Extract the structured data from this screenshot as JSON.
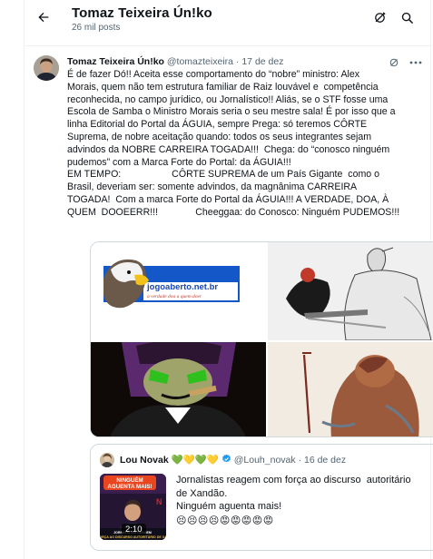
{
  "header": {
    "title": "Tomaz Teixeira Ún!ko",
    "post_count": "26 mil posts"
  },
  "tweet": {
    "author_name": "Tomaz Teixeira Ún!ko",
    "author_handle": "@tomazteixeira",
    "separator": "·",
    "date": "17 de dez",
    "text": "É de fazer Dó!! Aceita esse comportamento do “nobre” ministro: Alex\nMorais, quem não tem estrutura familiar de Raiz louvável e  competência\nreconhecida, no campo jurídico, ou Jornalístico!! Aliás, se o STF fosse uma\nEscola de Samba o Ministro Morais seria o seu mestre sala! É por isso que a\nlinha Editorial do Portal da ÁGUIA, sempre Prega: só teremos CÔRTE\nSuprema, de nobre aceitação quando: todos os seus integrantes sejam\nadvindos da NOBRE CARREIRA TOGADA!!!  Chega: do “conosco ninguém\npudemos” com a Marca Forte do Portal: da ÁGUIA!!!\nEM TEMPO:                   CÔRTE SUPREMA de um País Gigante  como o\nBrasil, deveriam ser: somente advindos, da magnânima CARREIRA\nTOGADA!  Com a marca Forte do Portal da ÁGUIA!!! A VERDADE, DOA, À\nQUEM  DOOEERR!!!              Cheeggaa: do Conosco: Ninguém PUDEMOS!!!",
    "media": {
      "logo_text": "jogoaberto.net.br",
      "logo_slogan": "a verdade doa a quem doer"
    }
  },
  "quote": {
    "author_name": "Lou Novak",
    "name_emojis": "💚💛💚💛",
    "author_handle": "@Louh_novak",
    "separator": "·",
    "date": "16 de dez",
    "text": "Jornalistas reagem com força ao discurso  autoritário\nde Xandão.\nNinguém aguenta mais!",
    "emojis": "😣😣😣😣😡😡😡😡😡",
    "video_duration": "2:10",
    "thumb_headline": "NINGUÉM AGUENTA MAIS!",
    "thumb_caption": "JORNALISTAS REAGEM COM FORÇA AO DISCURSO AUTORITÁRIO DE XANDÃO"
  },
  "colors": {
    "text": "#0f1419",
    "secondary": "#536471",
    "verified": "#1d9bf0",
    "border": "#cfd9de"
  },
  "icons": [
    "back-arrow-icon",
    "grok-icon",
    "search-icon",
    "more-icon",
    "verified-badge-icon"
  ]
}
